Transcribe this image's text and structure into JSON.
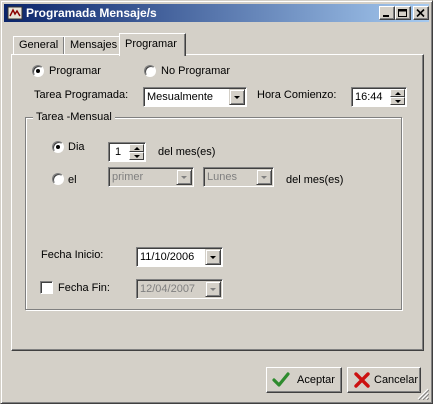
{
  "window": {
    "title": "Programada Mensaje/s",
    "icon": "app-icon"
  },
  "tabs": [
    {
      "label": "General"
    },
    {
      "label": "Mensajes"
    },
    {
      "label": "Programar"
    }
  ],
  "active_tab": "Programar",
  "schedule": {
    "programar_label": "Programar",
    "programar_selected": true,
    "no_programar_label": "No Programar",
    "no_programar_selected": false,
    "tarea_label": "Tarea Programada:",
    "tarea_value": "Mesualmente",
    "hora_label": "Hora Comienzo:",
    "hora_value": "16:44"
  },
  "mensual": {
    "title": "Tarea -Mensual",
    "dia_label": "Dia",
    "dia_selected": true,
    "dia_value": "1",
    "del_mes_1": "del mes(es)",
    "el_label": "el",
    "el_selected": false,
    "ordinal_value": "primer",
    "weekday_value": "Lunes",
    "del_mes_2": "del mes(es)",
    "fecha_inicio_label": "Fecha Inicio:",
    "fecha_inicio_value": "11/10/2006",
    "fecha_fin_label": "Fecha Fin:",
    "fecha_fin_checked": false,
    "fecha_fin_value": "12/04/2007"
  },
  "buttons": {
    "accept_label": "Aceptar",
    "cancel_label": "Cancelar"
  },
  "colors": {
    "titlebar_start": "#0a246a",
    "titlebar_end": "#a6caf0",
    "face": "#d4d0c8",
    "disabled_text": "#808080",
    "accept_icon": "#2e8b2e",
    "cancel_icon": "#cc1111"
  }
}
